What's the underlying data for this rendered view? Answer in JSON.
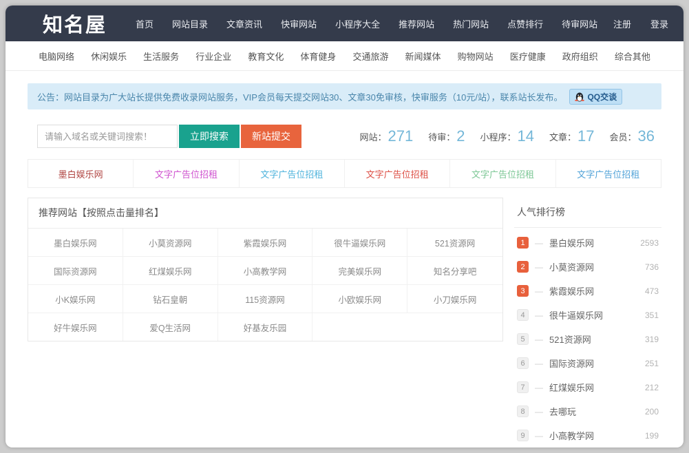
{
  "brand": {
    "logo": "知名屋"
  },
  "navbar": {
    "items": [
      "首页",
      "网站目录",
      "文章资讯",
      "快审网站",
      "小程序大全",
      "推荐网站",
      "热门网站",
      "点赞排行",
      "待审网站"
    ],
    "auth": [
      "注册",
      "登录"
    ]
  },
  "categories": [
    "电脑网络",
    "休闲娱乐",
    "生活服务",
    "行业企业",
    "教育文化",
    "体育健身",
    "交通旅游",
    "新闻媒体",
    "购物网站",
    "医疗健康",
    "政府组织",
    "综合其他"
  ],
  "announcement": {
    "text": "公告：网站目录为广大站长提供免费收录网站服务，VIP会员每天提交网站30、文章30免审核，快审服务（10元/站），联系站长发布。",
    "qq_button": "QQ交谈"
  },
  "search": {
    "placeholder": "请输入域名或关键词搜索！",
    "search_button": "立即搜索",
    "submit_button": "新站提交"
  },
  "stats": [
    {
      "label": "网站：",
      "value": "271"
    },
    {
      "label": "待审：",
      "value": "2"
    },
    {
      "label": "小程序：",
      "value": "14"
    },
    {
      "label": "文章：",
      "value": "17"
    },
    {
      "label": "会员：",
      "value": "36"
    }
  ],
  "ad_links": [
    {
      "label": "墨白娱乐网",
      "color": "#b04542"
    },
    {
      "label": "文字广告位招租",
      "color": "#cf52cf"
    },
    {
      "label": "文字广告位招租",
      "color": "#4fb3dc"
    },
    {
      "label": "文字广告位招租",
      "color": "#dd4f45"
    },
    {
      "label": "文字广告位招租",
      "color": "#7cc795"
    },
    {
      "label": "文字广告位招租",
      "color": "#52a3d8"
    }
  ],
  "recommended": {
    "title": "推荐网站【按照点击量排名】",
    "rows": [
      [
        "墨白娱乐网",
        "小莫资源网",
        "紫霞娱乐网",
        "很牛逼娱乐网",
        "521资源网"
      ],
      [
        "国际资源网",
        "红煤娱乐网",
        "小高教学网",
        "完美娱乐网",
        "知名分享吧"
      ],
      [
        "小K娱乐网",
        "钻石皇朝",
        "115资源网",
        "小欧娱乐网",
        "小刀娱乐网"
      ],
      [
        "好牛娱乐网",
        "爱Q生活网",
        "好基友乐园",
        "",
        ""
      ]
    ]
  },
  "ranking": {
    "title": "人气排行榜",
    "items": [
      {
        "rank": "1",
        "name": "墨白娱乐网",
        "count": "2593"
      },
      {
        "rank": "2",
        "name": "小莫资源网",
        "count": "736"
      },
      {
        "rank": "3",
        "name": "紫霞娱乐网",
        "count": "473"
      },
      {
        "rank": "4",
        "name": "很牛逼娱乐网",
        "count": "351"
      },
      {
        "rank": "5",
        "name": "521资源网",
        "count": "319"
      },
      {
        "rank": "6",
        "name": "国际资源网",
        "count": "251"
      },
      {
        "rank": "7",
        "name": "红煤娱乐网",
        "count": "212"
      },
      {
        "rank": "8",
        "name": "去哪玩",
        "count": "200"
      },
      {
        "rank": "9",
        "name": "小高教学网",
        "count": "199"
      }
    ]
  }
}
